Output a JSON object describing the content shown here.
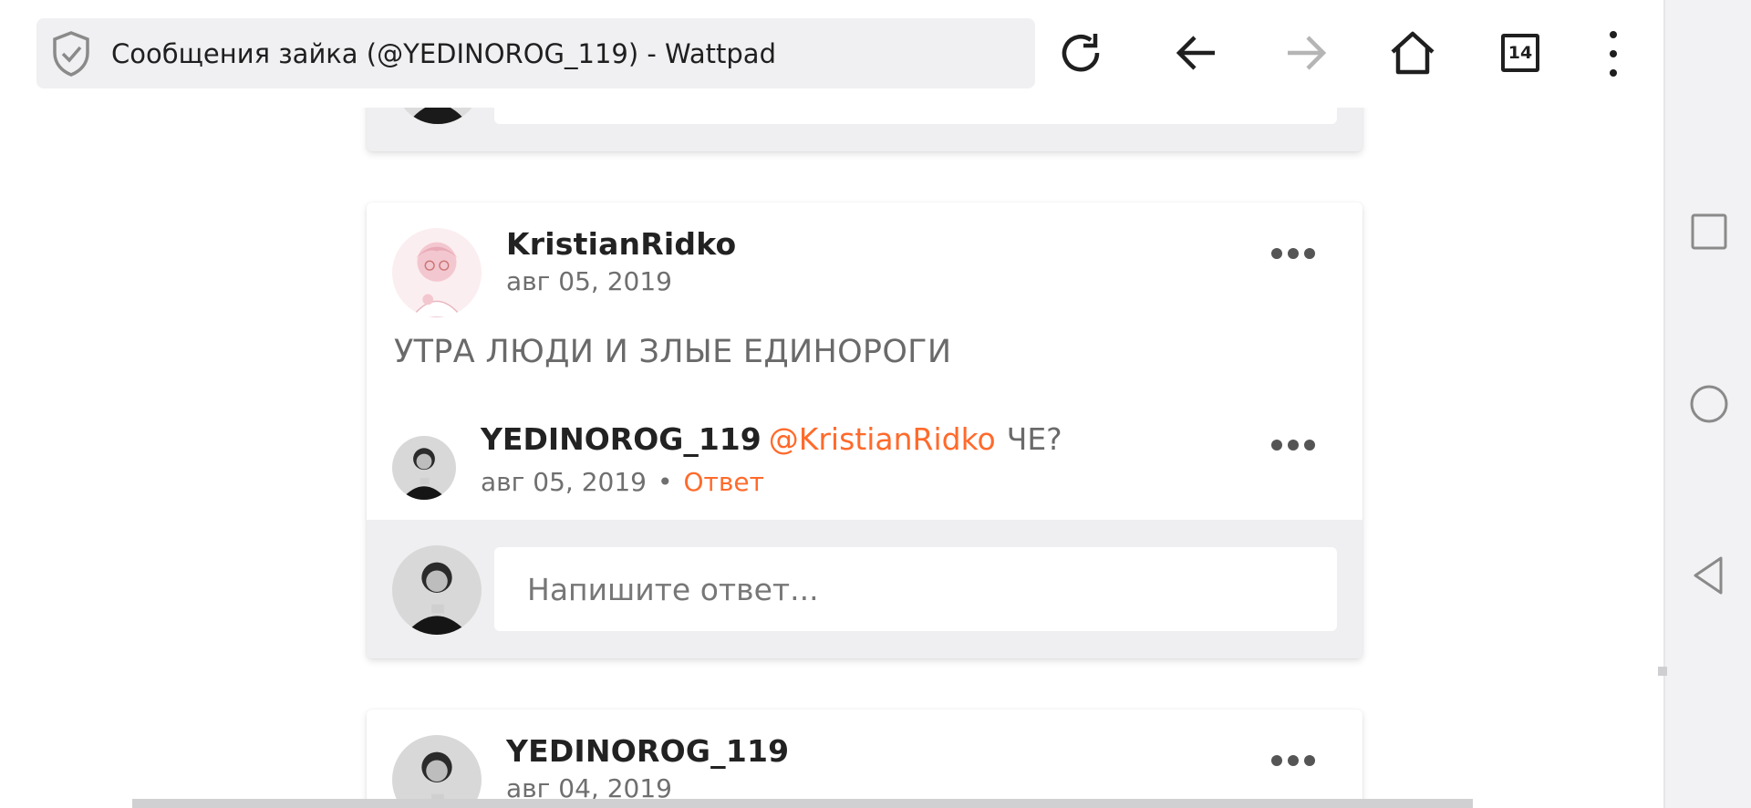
{
  "browser": {
    "page_title": "Сообщения зайка (@YEDINOROG_119) - Wattpad",
    "tab_count": "14",
    "icons": [
      "shield-icon",
      "reload-icon",
      "back-icon",
      "forward-icon",
      "home-icon",
      "tabs-icon",
      "more-icon"
    ]
  },
  "comments": [
    {
      "username": "KristianRidko",
      "date": "авг 05, 2019",
      "text": "УТРА ЛЮДИ И ЗЛЫЕ ЕДИНОРОГИ",
      "reply": {
        "username": "YEDINOROG_119",
        "mention": "@KristianRidko",
        "text": "ЧЕ?",
        "date": "авг 05, 2019",
        "separator": "•",
        "reply_label": "Ответ"
      },
      "reply_placeholder": "Напишите ответ..."
    },
    {
      "username": "YEDINOROG_119",
      "date": "авг 04, 2019"
    }
  ],
  "colors": {
    "accent": "#ff6a2b",
    "text_primary": "#222222",
    "text_secondary": "#6f6f6f",
    "card_gray": "#efeef0"
  },
  "navbar": {
    "icons": [
      "recent-apps-icon",
      "home-circle-icon",
      "back-triangle-icon"
    ]
  }
}
